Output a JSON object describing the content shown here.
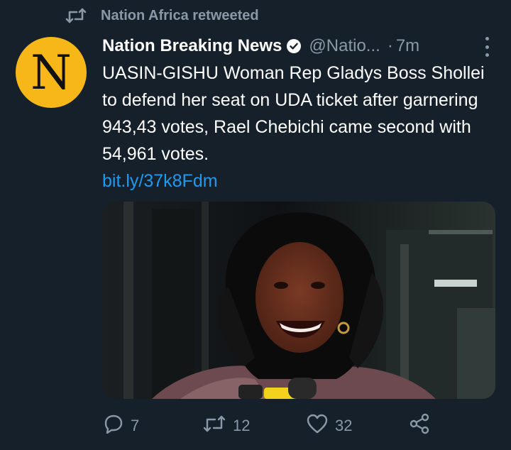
{
  "retweet": {
    "icon": "retweet-icon",
    "label": "Nation Africa retweeted"
  },
  "author": {
    "avatar_letter": "N",
    "avatar_color": "#f7b718",
    "name": "Nation Breaking News",
    "handle": "@Natio...",
    "separator": "·",
    "time": "7m"
  },
  "tweet": {
    "text": "UASIN-GISHU Woman Rep Gladys Boss Shollei to defend her seat on UDA ticket after garnering 943,43 votes, Rael Chebichi came second with 54,961 votes.",
    "link": "bit.ly/37k8Fdm"
  },
  "actions": {
    "reply_count": "7",
    "retweet_count": "12",
    "like_count": "32"
  },
  "colors": {
    "background": "#15202b",
    "secondary_text": "#8b98a5",
    "link": "#1d9bf0"
  }
}
